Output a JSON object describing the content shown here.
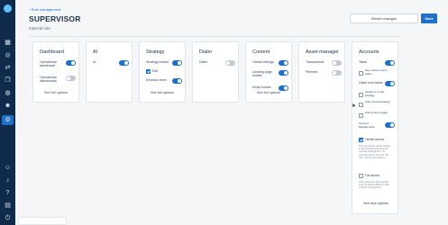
{
  "nav": {
    "back_label": "Role management"
  },
  "header": {
    "title": "SUPERVISOR",
    "subtitle": "Internal role",
    "revert_label": "Revert changes",
    "save_label": "Save"
  },
  "cards": {
    "dashboard": {
      "title": "Dashboard",
      "items": [
        {
          "label": "Operational dashboard",
          "on": true
        },
        {
          "label": "Operational dashboards",
          "on": false
        }
      ],
      "link": "See full options"
    },
    "ai": {
      "title": "AI",
      "items": [
        {
          "label": "AI",
          "on": true
        }
      ]
    },
    "strategy": {
      "title": "Strategy",
      "items": [
        {
          "label": "Strategy builder",
          "on": true
        },
        {
          "label": "Edit",
          "on": true
        },
        {
          "label": "Decision trees",
          "on": true
        }
      ],
      "link": "See full options"
    },
    "dialer": {
      "title": "Dialer",
      "items": [
        {
          "label": "Dialer",
          "on": false
        }
      ]
    },
    "content": {
      "title": "Content",
      "items": [
        {
          "label": "Global settings",
          "on": true
        },
        {
          "label": "Landing page builder",
          "on": true
        },
        {
          "label": "Email builder",
          "on": true
        }
      ],
      "link": "See full options"
    },
    "asset": {
      "title": "Asset manager",
      "items": [
        {
          "label": "Transactions",
          "on": false
        },
        {
          "label": "Partners",
          "on": false
        }
      ]
    },
    "accounts": {
      "title": "Accounts",
      "items": [
        {
          "label": "Tasks",
          "on": true
        },
        {
          "label": "See owners user's tasks",
          "on": false
        },
        {
          "label": "Claim user tasks",
          "on": true
        },
        {
          "label": "Assign to a new strategy",
          "on": false
        },
        {
          "label": "Stop current strategy",
          "on": false
        },
        {
          "label": "Add custom trigger",
          "on": false
        },
        {
          "label": "Account Management",
          "on": true
        },
        {
          "label": "Limited access",
          "on": true
        },
        {
          "label": "Full access",
          "on": false
        }
      ],
      "notes": {
        "limited": "This permission will be related to the settings defined in the account management. To eliminate all the limits for this user, edit the permissions.",
        "full": "This permission will override every limitation defined in the account management."
      },
      "link": "See less options"
    }
  }
}
